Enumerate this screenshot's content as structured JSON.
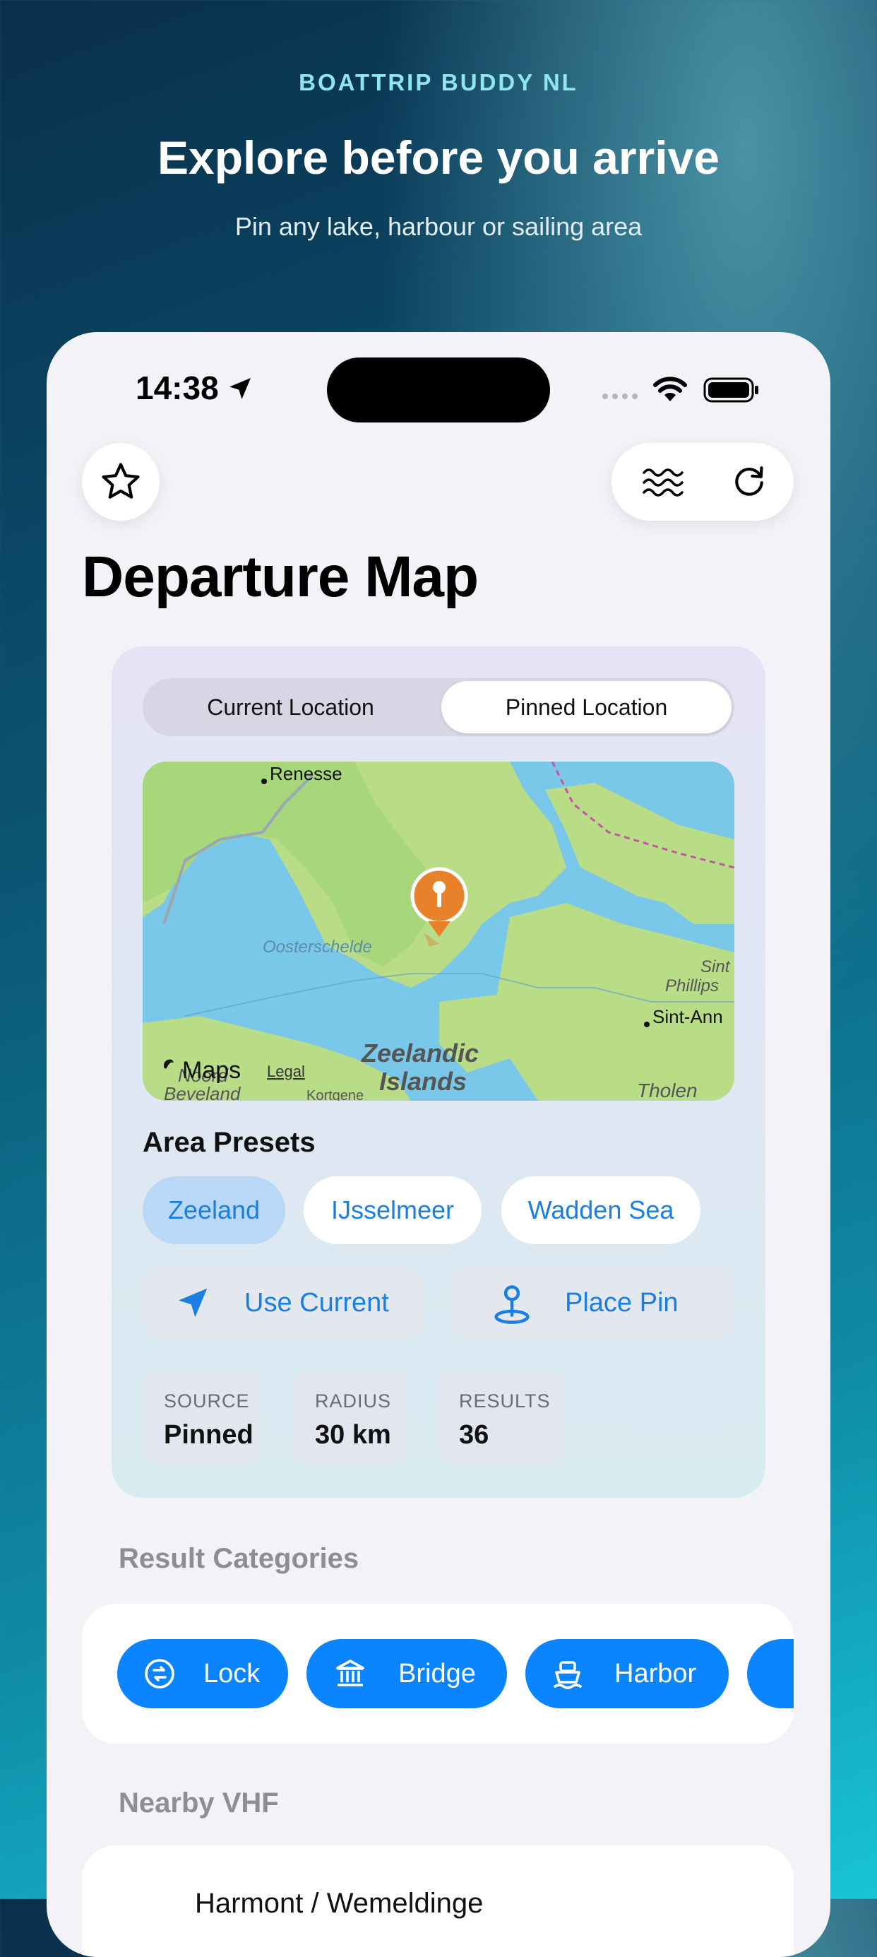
{
  "hero": {
    "brand": "BOATTRIP BUDDY NL",
    "headline": "Explore before you arrive",
    "subtitle": "Pin any lake, harbour or sailing area"
  },
  "status_bar": {
    "time": "14:38"
  },
  "toolbar": {
    "favorite_icon": "star-icon",
    "water_icon": "water-waves-icon",
    "refresh_icon": "refresh-icon"
  },
  "page": {
    "title": "Departure Map"
  },
  "location_mode": {
    "options": [
      "Current Location",
      "Pinned Location"
    ],
    "selected": "Pinned Location"
  },
  "map": {
    "labels": [
      "Renesse",
      "Oosterschelde",
      "Zeelandic",
      "Islands",
      "Sint",
      "Phillips",
      "Sint-Ann",
      "Tholen",
      "Noord",
      "Beveland",
      "Kortgene"
    ],
    "attribution": "Maps",
    "legal": "Legal"
  },
  "area_presets": {
    "title": "Area Presets",
    "items": [
      "Zeeland",
      "IJsselmeer",
      "Wadden Sea"
    ],
    "selected": "Zeeland"
  },
  "actions": {
    "use_current": "Use Current",
    "place_pin": "Place Pin"
  },
  "stats": [
    {
      "key": "SOURCE",
      "value": "Pinned"
    },
    {
      "key": "RADIUS",
      "value": "30 km"
    },
    {
      "key": "RESULTS",
      "value": "36"
    }
  ],
  "result_categories": {
    "title": "Result Categories",
    "items": [
      "Lock",
      "Bridge",
      "Harbor"
    ]
  },
  "nearby_vhf": {
    "title": "Nearby VHF",
    "first_item": "Harmont / Wemeldinge"
  },
  "colors": {
    "accent": "#0a84ff",
    "link_blue": "#1a7fe0",
    "chip_selected": "#b9d8f5",
    "pin_orange": "#e8822a"
  }
}
